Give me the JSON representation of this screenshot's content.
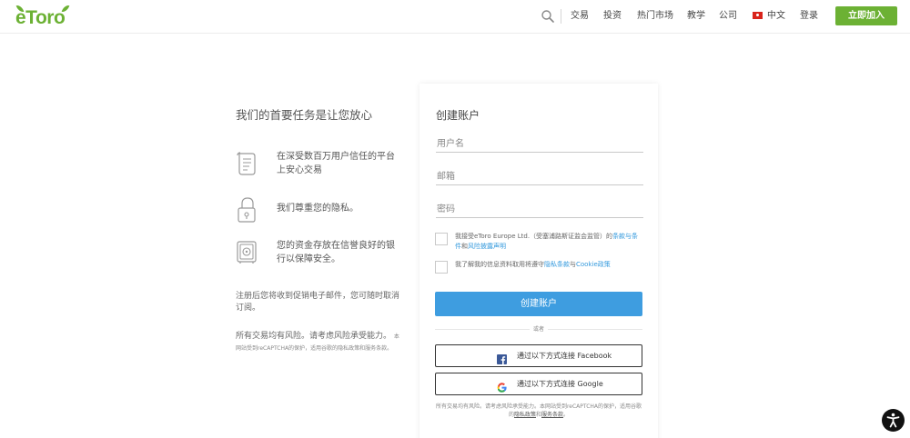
{
  "header": {
    "logo": "eToro",
    "nav": [
      "交易",
      "投资",
      "热门市场",
      "教学",
      "公司"
    ],
    "language": "中文",
    "login": "登录",
    "join": "立即加入"
  },
  "left": {
    "title": "我们的首要任务是让您放心",
    "features": [
      {
        "icon": "scroll-icon",
        "text": "在深受数百万用户信任的平台上安心交易"
      },
      {
        "icon": "padlock-icon",
        "text": "我们尊重您的隐私。"
      },
      {
        "icon": "safe-icon",
        "text": "您的资金存放在信誉良好的银行以保障安全。"
      }
    ],
    "note": "注册后您将收到促销电子邮件，您可随时取消订阅。",
    "risk_main": "所有交易均有风险。请考虑风险承受能力。",
    "risk_small_prefix": "本网站受到reCAPTCHA的保护，适用谷歌的",
    "privacy_link": "隐私政策",
    "and": "和",
    "terms_link": "服务条款",
    "end": "。"
  },
  "form": {
    "title": "创建账户",
    "username_placeholder": "用户名",
    "email_placeholder": "邮箱",
    "password_placeholder": "密码",
    "check1_prefix": "我接受eToro Europe Ltd.（受塞浦路斯证监会监管）的",
    "check1_link1": "条款与条件",
    "check1_mid": "和",
    "check1_link2": "风险披露声明",
    "check2_prefix": "我了解我的信息资料取用将遵守",
    "check2_link1": "隐私条款",
    "check2_mid": "与",
    "check2_link2": "Cookie政策",
    "create_button": "创建账户",
    "or": "或者",
    "facebook_button": "通过以下方式连接 Facebook",
    "google_button": "通过以下方式连接 Google",
    "footer_prefix": "所有交易均有风险。请考虑风险承受能力。本网站受到reCAPTCHA的保护，适用谷歌的",
    "footer_link1": "隐私政策",
    "footer_mid": "和",
    "footer_link2": "服务条款",
    "footer_end": "。"
  },
  "colors": {
    "brand_green": "#6cb134",
    "primary_blue": "#3e9de0",
    "link_blue": "#3399dd",
    "facebook_blue": "#3b5998"
  }
}
